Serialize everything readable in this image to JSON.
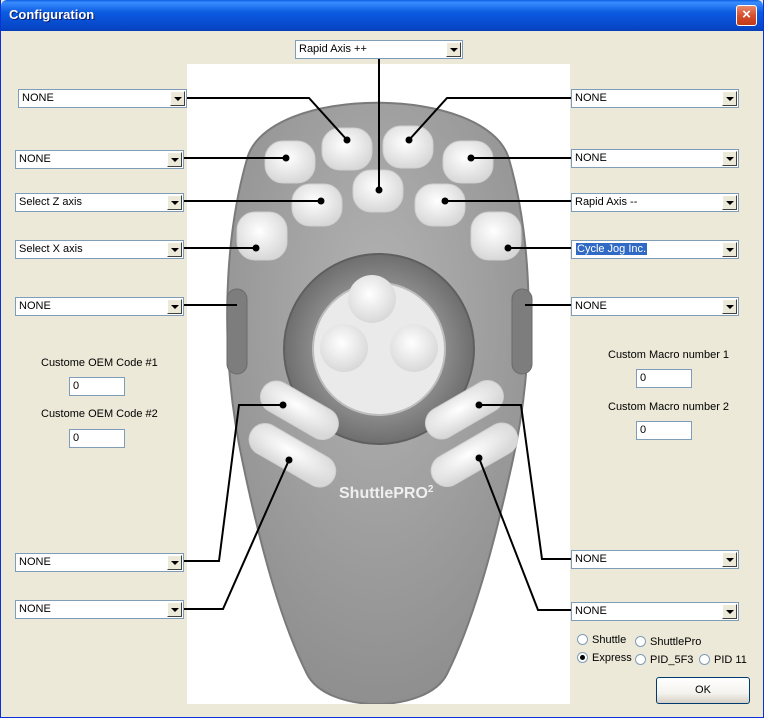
{
  "window": {
    "title": "Configuration",
    "close_label": "×"
  },
  "dropdowns": {
    "top_center": "Rapid Axis ++",
    "left_1": "NONE",
    "left_2": "NONE",
    "left_3": "Select Z axis",
    "left_4": "Select X axis",
    "left_5": "NONE",
    "left_6": "NONE",
    "left_7": "NONE",
    "right_1": "NONE",
    "right_2": "NONE",
    "right_3": "Rapid Axis --",
    "right_4": "Cycle Jog Inc.",
    "right_5": "NONE",
    "right_6": "NONE",
    "right_7": "NONE"
  },
  "oem": {
    "label_1": "Custome OEM Code #1",
    "value_1": "0",
    "label_2": "Custome OEM Code #2",
    "value_2": "0"
  },
  "macro": {
    "label_1": "Custom Macro number 1",
    "value_1": "0",
    "label_2": "Custom Macro number 2",
    "value_2": "0"
  },
  "device_radios": {
    "shuttle": "Shuttle",
    "shuttlepro": "ShuttlePro",
    "express": "Express",
    "pid_5f3": "PID_5F3",
    "pid_11": "PID 11",
    "selected": "express"
  },
  "device_logo": {
    "text_main": "ShuttlePRO",
    "text_sup": "2"
  },
  "ok_label": "OK",
  "colors": {
    "titlebar": "#0a52d8",
    "dialog_bg": "#ece9d8",
    "selection": "#316ac5",
    "device_body": "#9a9a9a"
  }
}
